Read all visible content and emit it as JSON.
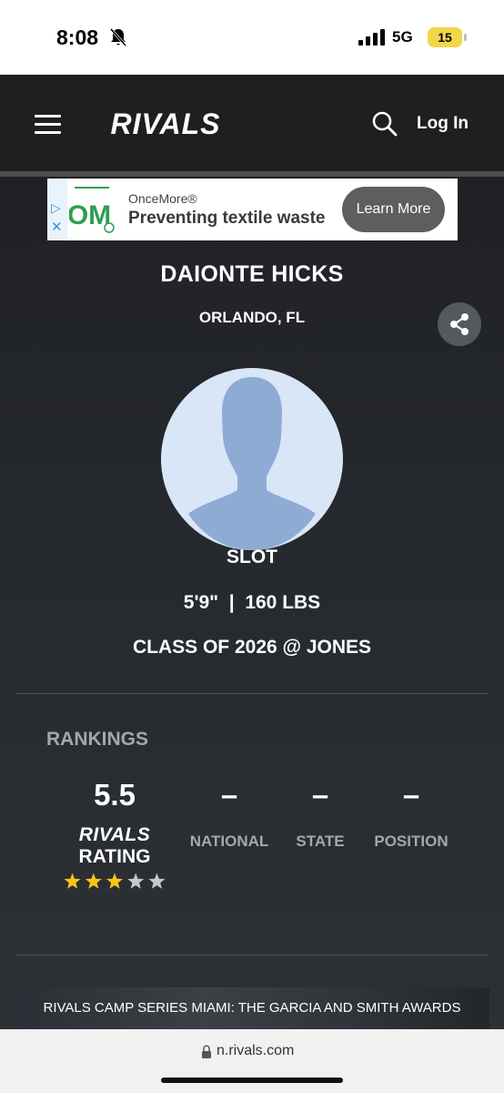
{
  "status_bar": {
    "time": "8:08",
    "network": "5G",
    "battery_level": "15",
    "icons": [
      "bell-slash-icon",
      "signal-icon"
    ]
  },
  "header": {
    "logo_text": "RIVALS",
    "login_label": "Log In",
    "icons": [
      "menu-icon",
      "search-icon"
    ]
  },
  "ad": {
    "logo_text": "OM",
    "brand": "OnceMore®",
    "headline": "Preventing textile waste",
    "button_label": "Learn More",
    "icons": [
      "ad-play-icon",
      "ad-close-icon"
    ]
  },
  "profile": {
    "name": "DAIONTE HICKS",
    "location": "ORLANDO, FL",
    "position": "SLOT",
    "measurements": "5'9\"  |  160 LBS",
    "class": "CLASS OF 2026 @ JONES",
    "icons": [
      "share-icon",
      "avatar-placeholder-icon"
    ]
  },
  "rankings": {
    "heading": "RANKINGS",
    "rating_value": "5.5",
    "rating_logo": "RIVALS",
    "rating_label": "RATING",
    "stars_filled": 3,
    "stars_total": 5,
    "columns": [
      {
        "value": "–",
        "label": "NATIONAL"
      },
      {
        "value": "–",
        "label": "STATE"
      },
      {
        "value": "–",
        "label": "POSITION"
      }
    ]
  },
  "news": {
    "headline": "RIVALS CAMP SERIES MIAMI: THE GARCIA AND SMITH AWARDS"
  },
  "browser": {
    "url": "n.rivals.com",
    "icons": [
      "lock-icon"
    ]
  },
  "colors": {
    "header_bg": "#1f1f1f",
    "star_filled": "#f5c518",
    "star_empty": "#c8c8c8",
    "muted_text": "#a5a7aa",
    "avatar_bg": "#d8e6f7",
    "avatar_figure": "#8eabd4"
  }
}
